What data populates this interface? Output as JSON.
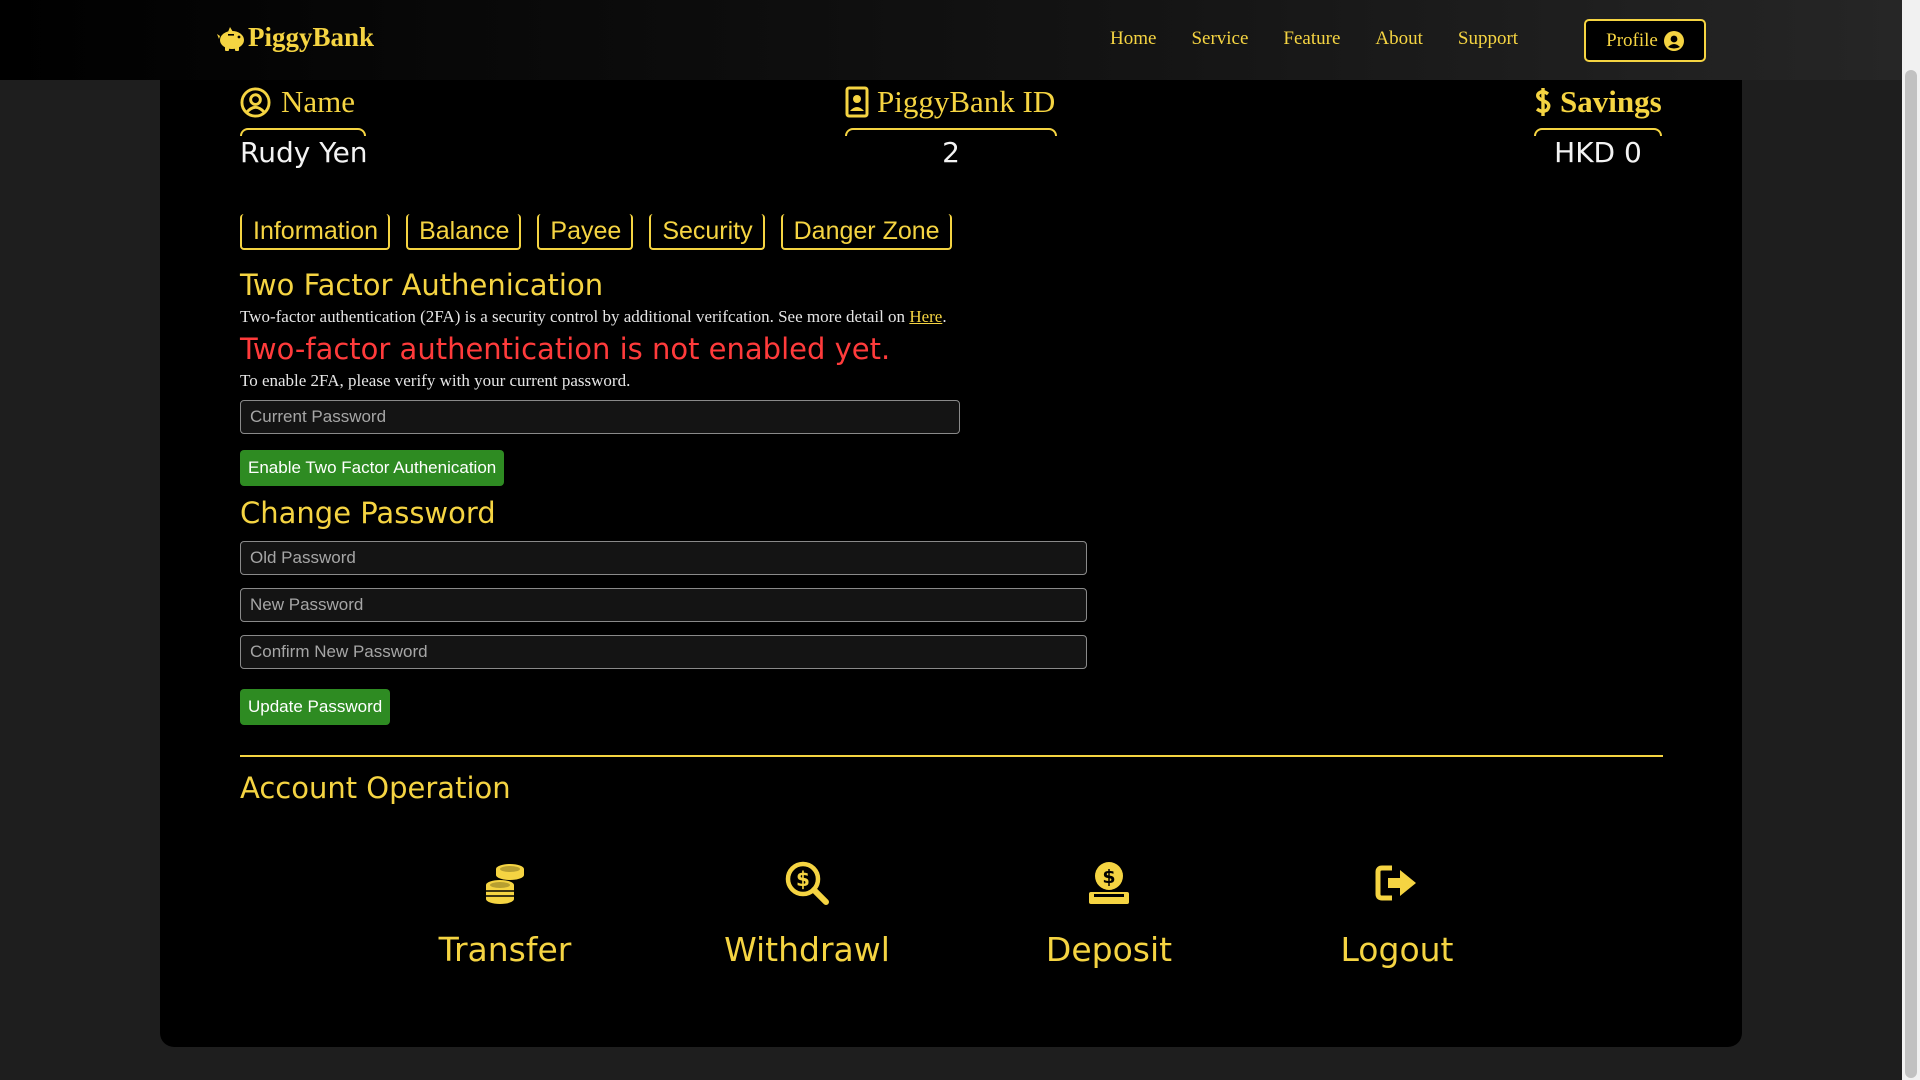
{
  "nav": {
    "brand": "PiggyBank",
    "links": [
      "Home",
      "Service",
      "Feature",
      "About",
      "Support"
    ],
    "profile": "Profile"
  },
  "info": {
    "name_label": "Name",
    "name_value": "Rudy Yen",
    "id_label": "PiggyBank ID",
    "id_value": "2",
    "savings_label": "Savings",
    "savings_value": "HKD 0"
  },
  "tabs": [
    "Information",
    "Balance",
    "Payee",
    "Security",
    "Danger Zone"
  ],
  "two_factor": {
    "title": "Two Factor Authenication",
    "description": "Two-factor authentication (2FA) is a security control by additional verifcation. See more detail on ",
    "link_text": "Here",
    "after_link": ".",
    "status": "Two-factor authentication is not enabled yet.",
    "instruction": "To enable 2FA, please verify with your current password.",
    "password_placeholder": "Current Password",
    "button": "Enable Two Factor Authenication"
  },
  "change_password": {
    "title": "Change Password",
    "old_placeholder": "Old Password",
    "new_placeholder": "New Password",
    "confirm_placeholder": "Confirm New Password",
    "button": "Update Password"
  },
  "operations": {
    "title": "Account Operation",
    "items": [
      "Transfer",
      "Withdrawl",
      "Deposit",
      "Logout"
    ]
  },
  "colors": {
    "accent": "#f5d442",
    "warning": "#ff3b3b",
    "button_green": "#2e8b22"
  }
}
